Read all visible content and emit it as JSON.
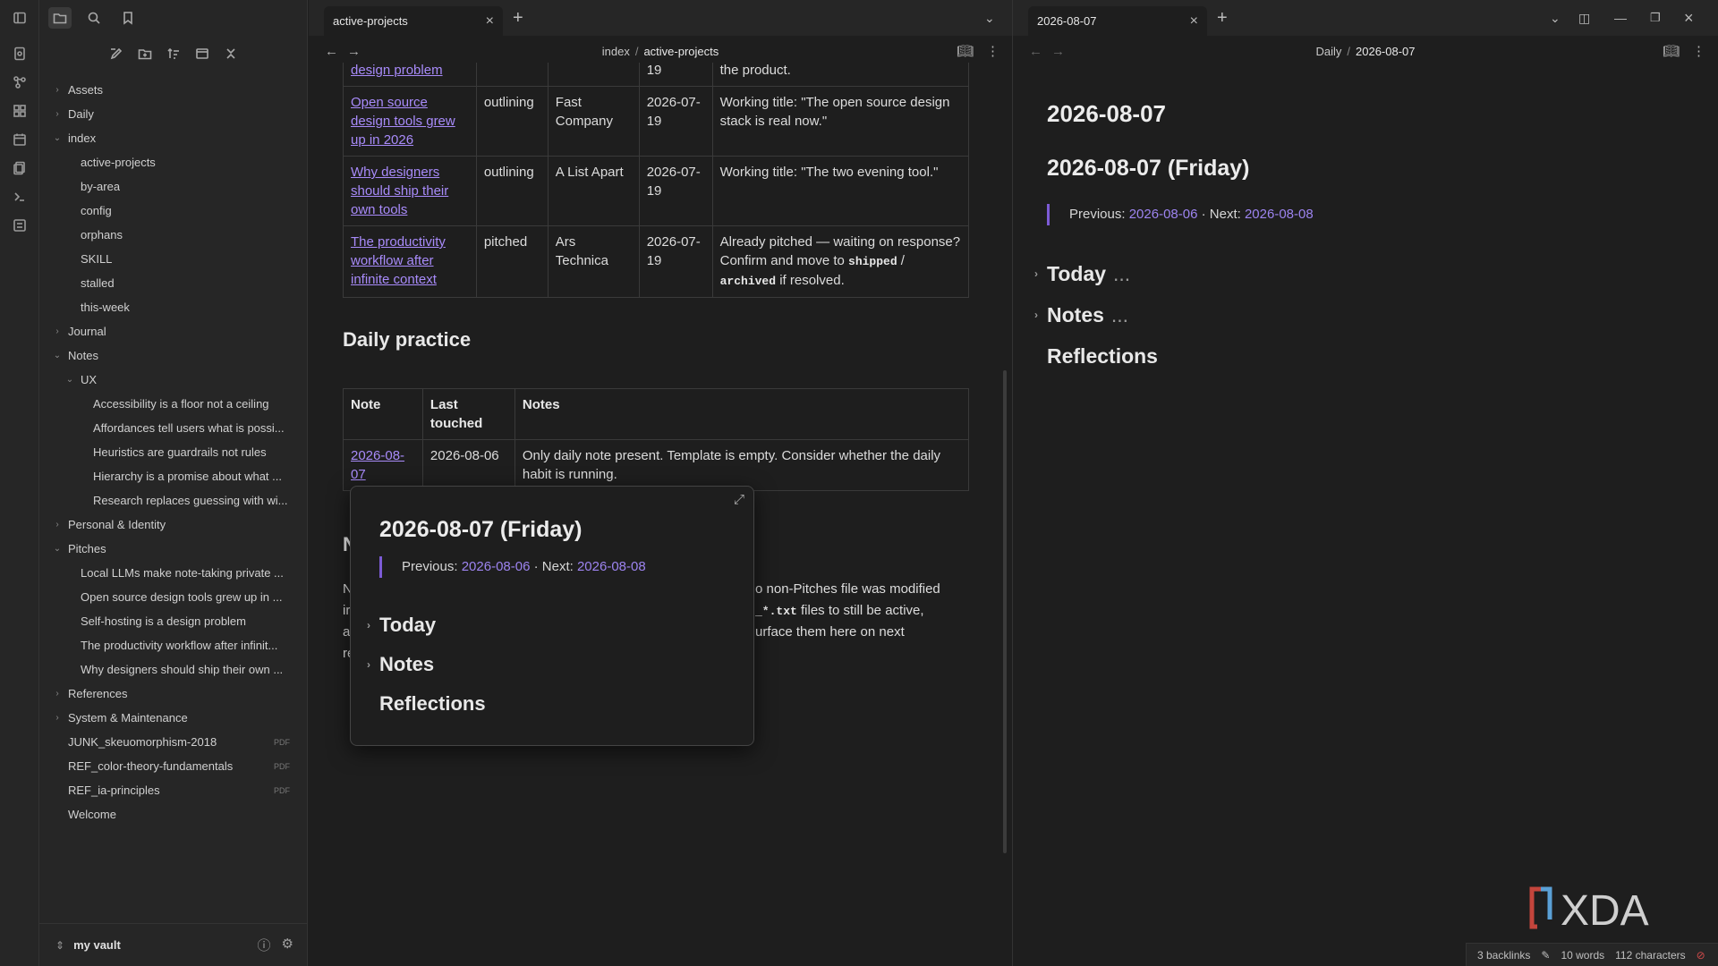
{
  "sidebar": {
    "tree": [
      {
        "label": "Assets",
        "chev": "›",
        "indent": 0
      },
      {
        "label": "Daily",
        "chev": "›",
        "indent": 0
      },
      {
        "label": "index",
        "chev": "⌄",
        "indent": 0
      },
      {
        "label": "active-projects",
        "chev": "",
        "indent": 1
      },
      {
        "label": "by-area",
        "chev": "",
        "indent": 1
      },
      {
        "label": "config",
        "chev": "",
        "indent": 1
      },
      {
        "label": "orphans",
        "chev": "",
        "indent": 1
      },
      {
        "label": "SKILL",
        "chev": "",
        "indent": 1
      },
      {
        "label": "stalled",
        "chev": "",
        "indent": 1
      },
      {
        "label": "this-week",
        "chev": "",
        "indent": 1
      },
      {
        "label": "Journal",
        "chev": "›",
        "indent": 0
      },
      {
        "label": "Notes",
        "chev": "⌄",
        "indent": 0
      },
      {
        "label": "UX",
        "chev": "⌄",
        "indent": 1
      },
      {
        "label": "Accessibility is a floor not a ceiling",
        "chev": "",
        "indent": 2
      },
      {
        "label": "Affordances tell users what is possi...",
        "chev": "",
        "indent": 2
      },
      {
        "label": "Heuristics are guardrails not rules",
        "chev": "",
        "indent": 2
      },
      {
        "label": "Hierarchy is a promise about what ...",
        "chev": "",
        "indent": 2
      },
      {
        "label": "Research replaces guessing with wi...",
        "chev": "",
        "indent": 2
      },
      {
        "label": "Personal & Identity",
        "chev": "›",
        "indent": 0
      },
      {
        "label": "Pitches",
        "chev": "⌄",
        "indent": 0
      },
      {
        "label": "Local LLMs make note-taking private ...",
        "chev": "",
        "indent": 1
      },
      {
        "label": "Open source design tools grew up in ...",
        "chev": "",
        "indent": 1
      },
      {
        "label": "Self-hosting is a design problem",
        "chev": "",
        "indent": 1
      },
      {
        "label": "The productivity workflow after infinit...",
        "chev": "",
        "indent": 1
      },
      {
        "label": "Why designers should ship their own ...",
        "chev": "",
        "indent": 1
      },
      {
        "label": "References",
        "chev": "›",
        "indent": 0
      },
      {
        "label": "System & Maintenance",
        "chev": "›",
        "indent": 0
      },
      {
        "label": "JUNK_skeuomorphism-2018",
        "chev": "",
        "indent": 0,
        "ext": "PDF"
      },
      {
        "label": "REF_color-theory-fundamentals",
        "chev": "",
        "indent": 0,
        "ext": "PDF"
      },
      {
        "label": "REF_ia-principles",
        "chev": "",
        "indent": 0,
        "ext": "PDF"
      },
      {
        "label": "Welcome",
        "chev": "",
        "indent": 0
      }
    ],
    "vault_name": "my vault"
  },
  "left_tab": {
    "title": "active-projects",
    "close": "×",
    "plus": "+"
  },
  "right_tab": {
    "title": "2026-08-07",
    "close": "×",
    "plus": "+"
  },
  "left_view": {
    "breadcrumb_parent": "index",
    "breadcrumb_sep": "/",
    "breadcrumb_current": "active-projects",
    "pitch_rows": [
      {
        "note": "design problem",
        "status": "",
        "venue": "",
        "date": "19",
        "notes": "the product."
      },
      {
        "note": "Open source design tools grew up in 2026",
        "status": "outlining",
        "venue": "Fast Company",
        "date": "2026-07-19",
        "notes": "Working title: \"The open source design stack is real now.\""
      },
      {
        "note": "Why designers should ship their own tools",
        "status": "outlining",
        "venue": "A List Apart",
        "date": "2026-07-19",
        "notes": "Working title: \"The two evening tool.\""
      },
      {
        "note": "The productivity workflow after infinite context",
        "status": "pitched",
        "venue": "Ars Technica",
        "date": "2026-07-19",
        "notes_pre": "Already pitched — waiting on response? Confirm and move to",
        "code1": "shipped",
        "slash": "/",
        "code2": "archived",
        "notes_post": "if resolved."
      }
    ],
    "daily_heading": "Daily practice",
    "daily_headers": {
      "note": "Note",
      "last": "Last touched",
      "notes": "Notes"
    },
    "daily_row": {
      "note": "2026-08-07",
      "last": "2026-08-06",
      "notes": "Only daily note present. Template is empty. Consider whether the daily habit is running."
    },
    "hidden_heading_initial": "N",
    "hidden_para": {
      "line1_left": "N",
      "line1_right": "o non-Pitches file was modified",
      "line2_left": "ir",
      "line2_code": "_*.txt",
      "line2_right": "files to still be active,",
      "line3_left": "a",
      "line3_right": "urface them here on next",
      "line4_left": "re"
    }
  },
  "popover": {
    "title": "2026-08-07 (Friday)",
    "prev_label": "Previous:",
    "prev_link": "2026-08-06",
    "dot": "·",
    "next_label": "Next:",
    "next_link": "2026-08-08",
    "sections": [
      "Today",
      "Notes",
      "Reflections"
    ]
  },
  "right_view": {
    "breadcrumb_parent": "Daily",
    "breadcrumb_sep": "/",
    "breadcrumb_current": "2026-08-07",
    "inline_title": "2026-08-07",
    "h1": "2026-08-07 (Friday)",
    "prev_label": "Previous:",
    "prev_link": "2026-08-06",
    "dot": "·",
    "next_label": "Next:",
    "next_link": "2026-08-08",
    "sections": [
      "Today",
      "Notes",
      "Reflections"
    ],
    "ellipsis": "..."
  },
  "status": {
    "backlinks": "3 backlinks",
    "words": "10 words",
    "chars": "112 characters"
  },
  "watermark": "XDA",
  "colors": {
    "accent": "#a88bfa",
    "background": "#1e1e1e",
    "sidebar": "#262626"
  }
}
